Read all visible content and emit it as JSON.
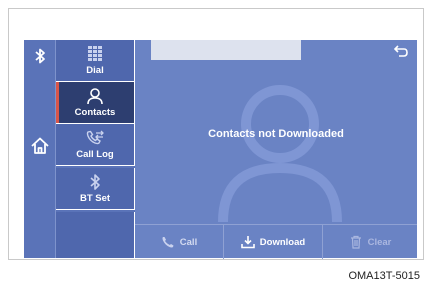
{
  "sidebar": {
    "items": [
      {
        "label": "Dial",
        "icon": "dialpad-icon"
      },
      {
        "label": "Contacts",
        "icon": "person-icon",
        "active": true
      },
      {
        "label": "Call Log",
        "icon": "phone-arrows-icon"
      },
      {
        "label": "BT Set",
        "icon": "bluetooth-icon"
      }
    ]
  },
  "main": {
    "status_message": "Contacts not Downloaded"
  },
  "bottom_bar": {
    "call_label": "Call",
    "download_label": "Download",
    "clear_label": "Clear"
  },
  "figure_code": "OMA13T-5015",
  "colors": {
    "screen_bg": "#5a73b8",
    "main_bg": "#6a83c4",
    "active_item_bg": "#2d3e70",
    "active_accent": "#d8554a"
  }
}
